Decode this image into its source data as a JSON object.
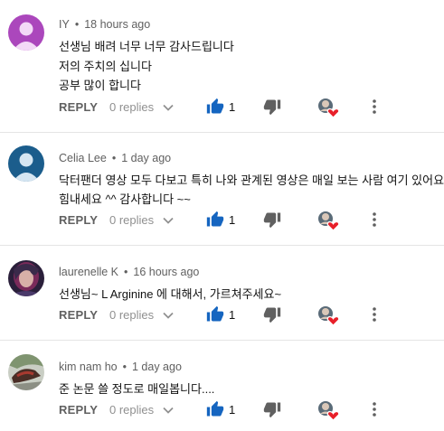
{
  "colors": {
    "link_blue": "#1565c0",
    "meta_gray": "#606060",
    "heart_red": "#e8202a",
    "divider": "#e5e5e5"
  },
  "icons": {
    "like": "thumbs-up-icon",
    "dislike": "thumbs-down-icon",
    "creator_heart": "creator-heart-icon",
    "more": "more-vert-icon",
    "expand": "chevron-down-icon"
  },
  "comments": [
    {
      "author": "IY",
      "separator": "•",
      "time": "18 hours ago",
      "lines": [
        "선생님 배려 너무 너무 감사드립니다",
        "저의 주치의 십니다",
        "공부 많이 합니다"
      ],
      "reply_label": "REPLY",
      "replies_label": "0 replies",
      "likes": "1",
      "liked": true,
      "hearted": true
    },
    {
      "author": "Celia Lee",
      "separator": "•",
      "time": "1 day ago",
      "lines": [
        "닥터팬더 영상 모두 다보고 특히 나와 관계된 영상은 매일 보는 사람 여기 있어요!!",
        "힘내세요 ^^ 감사합니다 ~~"
      ],
      "reply_label": "REPLY",
      "replies_label": "0 replies",
      "likes": "1",
      "liked": true,
      "hearted": true
    },
    {
      "author": "laurenelle K",
      "separator": "•",
      "time": "16 hours ago",
      "lines": [
        "선생님~  L Arginine 에 대해서, 가르쳐주세요~"
      ],
      "reply_label": "REPLY",
      "replies_label": "0 replies",
      "likes": "1",
      "liked": true,
      "hearted": true
    },
    {
      "author": "kim nam ho",
      "separator": "•",
      "time": "1 day ago",
      "lines": [
        "준 논문 쓸 정도로 매일봅니다...."
      ],
      "reply_label": "REPLY",
      "replies_label": "0 replies",
      "likes": "1",
      "liked": true,
      "hearted": true
    }
  ]
}
